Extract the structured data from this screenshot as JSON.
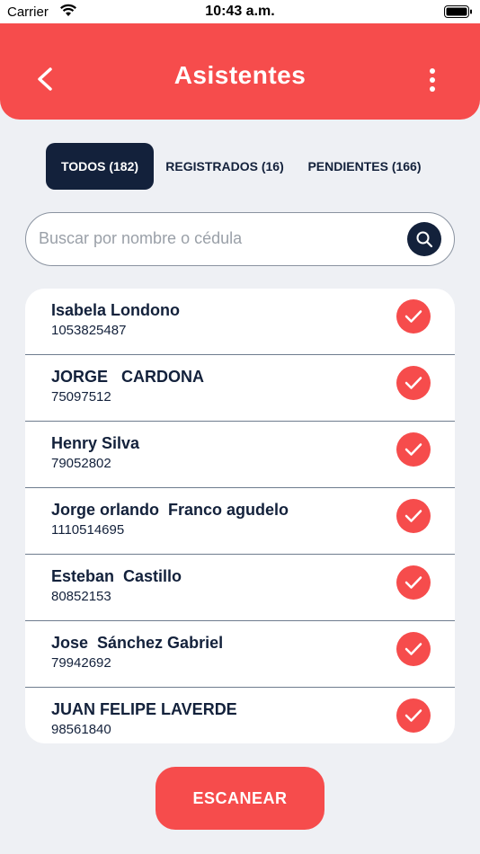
{
  "status_bar": {
    "carrier": "Carrier",
    "time": "10:43 a.m."
  },
  "header": {
    "title": "Asistentes",
    "back_icon": "chevron-left-icon",
    "menu_icon": "more-vertical-icon",
    "color": "#f64c4c"
  },
  "tabs": [
    {
      "label": "TODOS (182)",
      "active": true
    },
    {
      "label": "REGISTRADOS (16)",
      "active": false
    },
    {
      "label": "PENDIENTES (166)",
      "active": false
    }
  ],
  "search": {
    "placeholder": "Buscar por nombre o cédula",
    "value": "",
    "icon": "search-icon"
  },
  "attendees": [
    {
      "name": "Isabela Londono",
      "id": "1053825487",
      "registered": true
    },
    {
      "name": "JORGE   CARDONA",
      "id": "75097512",
      "registered": true
    },
    {
      "name": "Henry Silva",
      "id": "79052802",
      "registered": true
    },
    {
      "name": "Jorge orlando  Franco agudelo",
      "id": "1110514695",
      "registered": true
    },
    {
      "name": "Esteban  Castillo",
      "id": "80852153",
      "registered": true
    },
    {
      "name": "Jose  Sánchez Gabriel",
      "id": "79942692",
      "registered": true
    },
    {
      "name": "JUAN FELIPE LAVERDE",
      "id": "98561840",
      "registered": true
    }
  ],
  "scan_button": {
    "label": "ESCANEAR"
  },
  "colors": {
    "accent": "#f64c4c",
    "navy": "#13213b",
    "background": "#eef0f4"
  }
}
